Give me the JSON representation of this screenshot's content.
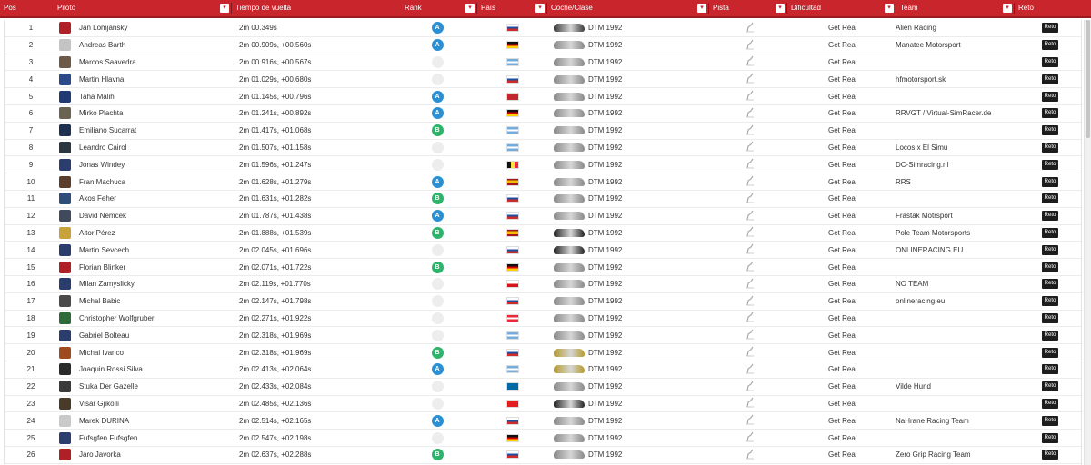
{
  "colors": {
    "header": "#c9252c",
    "rank_a": "#2b8fd3",
    "rank_b": "#2db36a",
    "reto": "#1d1d1d"
  },
  "headers": [
    {
      "key": "pos",
      "label": "Pos",
      "w": 59,
      "sortable": false
    },
    {
      "key": "piloto",
      "label": "Piloto",
      "w": 196,
      "sortable": true
    },
    {
      "key": "tiempo",
      "label": "Tiempo de vuelta",
      "w": 186,
      "sortable": false
    },
    {
      "key": "rank",
      "label": "Rank",
      "w": 84,
      "sortable": true
    },
    {
      "key": "pais",
      "label": "País",
      "w": 77,
      "sortable": true
    },
    {
      "key": "coche",
      "label": "Coche/Clase",
      "w": 178,
      "sortable": true
    },
    {
      "key": "pista",
      "label": "Pista",
      "w": 86,
      "sortable": true
    },
    {
      "key": "dificultad",
      "label": "Dificultad",
      "w": 120,
      "sortable": true
    },
    {
      "key": "team",
      "label": "Team",
      "w": 130,
      "sortable": true
    },
    {
      "key": "reto",
      "label": "Reto",
      "w": 84,
      "sortable": false
    }
  ],
  "reto_label": "Reto",
  "rows": [
    {
      "pos": "1",
      "name": "Jan Lomjansky",
      "time": "2m 00.349s",
      "rank": "A",
      "flag": "sk",
      "car_color": "#3a3a3a",
      "class": "DTM 1992",
      "difficulty": "Get Real",
      "team": "Alien Racing",
      "avatar_color": "#b02027"
    },
    {
      "pos": "2",
      "name": "Andreas Barth",
      "time": "2m 00.909s, +00.560s",
      "rank": "A",
      "flag": "de",
      "car_color": "#8a8a8a",
      "class": "DTM 1992",
      "difficulty": "Get Real",
      "team": "Manatee Motorsport",
      "avatar_color": "#c4c4c4"
    },
    {
      "pos": "3",
      "name": "Marcos Saavedra",
      "time": "2m 00.916s, +00.567s",
      "rank": "",
      "flag": "ar",
      "car_color": "#8a8a8a",
      "class": "DTM 1992",
      "difficulty": "Get Real",
      "team": "",
      "avatar_color": "#6d5a48"
    },
    {
      "pos": "4",
      "name": "Martin Hlavna",
      "time": "2m 01.029s, +00.680s",
      "rank": "",
      "flag": "sk",
      "car_color": "#8a8a8a",
      "class": "DTM 1992",
      "difficulty": "Get Real",
      "team": "hfmotorsport.sk",
      "avatar_color": "#2b4a8a"
    },
    {
      "pos": "5",
      "name": "Taha Malih",
      "time": "2m 01.145s, +00.796s",
      "rank": "A",
      "flag": "ma",
      "car_color": "#8a8a8a",
      "class": "DTM 1992",
      "difficulty": "Get Real",
      "team": "",
      "avatar_color": "#203a73"
    },
    {
      "pos": "6",
      "name": "Mirko Plachta",
      "time": "2m 01.241s, +00.892s",
      "rank": "A",
      "flag": "de",
      "car_color": "#8a8a8a",
      "class": "DTM 1992",
      "difficulty": "Get Real",
      "team": "RRVGT / Virtual-SimRacer.de",
      "avatar_color": "#6b6352"
    },
    {
      "pos": "7",
      "name": "Emiliano Sucarrat",
      "time": "2m 01.417s, +01.068s",
      "rank": "B",
      "flag": "ar",
      "car_color": "#8a8a8a",
      "class": "DTM 1992",
      "difficulty": "Get Real",
      "team": "",
      "avatar_color": "#1e2f4f"
    },
    {
      "pos": "8",
      "name": "Leandro Cairol",
      "time": "2m 01.507s, +01.158s",
      "rank": "",
      "flag": "ar",
      "car_color": "#8a8a8a",
      "class": "DTM 1992",
      "difficulty": "Get Real",
      "team": "Locos x El Simu",
      "avatar_color": "#2a3640"
    },
    {
      "pos": "9",
      "name": "Jonas Windey",
      "time": "2m 01.596s, +01.247s",
      "rank": "",
      "flag": "be",
      "car_color": "#8a8a8a",
      "class": "DTM 1992",
      "difficulty": "Get Real",
      "team": "DC-Simracing.nl",
      "avatar_color": "#2a3d6e"
    },
    {
      "pos": "10",
      "name": "Fran Machuca",
      "time": "2m 01.628s, +01.279s",
      "rank": "A",
      "flag": "es",
      "car_color": "#8a8a8a",
      "class": "DTM 1992",
      "difficulty": "Get Real",
      "team": "RRS",
      "avatar_color": "#5a3d2a"
    },
    {
      "pos": "11",
      "name": "Akos Feher",
      "time": "2m 01.631s, +01.282s",
      "rank": "B",
      "flag": "sk",
      "car_color": "#8a8a8a",
      "class": "DTM 1992",
      "difficulty": "Get Real",
      "team": "",
      "avatar_color": "#2e4d7a"
    },
    {
      "pos": "12",
      "name": "David Nemcek",
      "time": "2m 01.787s, +01.438s",
      "rank": "A",
      "flag": "sk",
      "car_color": "#8a8a8a",
      "class": "DTM 1992",
      "difficulty": "Get Real",
      "team": "Fraštâk Motrsport",
      "avatar_color": "#3f4a5c"
    },
    {
      "pos": "13",
      "name": "Aitor Pérez",
      "time": "2m 01.888s, +01.539s",
      "rank": "B",
      "flag": "es",
      "car_color": "#222222",
      "class": "DTM 1992",
      "difficulty": "Get Real",
      "team": "Pole Team Motorsports",
      "avatar_color": "#c8a23a"
    },
    {
      "pos": "14",
      "name": "Martin Sevcech",
      "time": "2m 02.045s, +01.696s",
      "rank": "",
      "flag": "sk",
      "car_color": "#222222",
      "class": "DTM 1992",
      "difficulty": "Get Real",
      "team": "ONLINERACING.EU",
      "avatar_color": "#2a3d6e"
    },
    {
      "pos": "15",
      "name": "Florian Blinker",
      "time": "2m 02.071s, +01.722s",
      "rank": "B",
      "flag": "de",
      "car_color": "#8a8a8a",
      "class": "DTM 1992",
      "difficulty": "Get Real",
      "team": "",
      "avatar_color": "#b02027"
    },
    {
      "pos": "16",
      "name": "Milan Zamyslicky",
      "time": "2m 02.119s, +01.770s",
      "rank": "",
      "flag": "cz",
      "car_color": "#8a8a8a",
      "class": "DTM 1992",
      "difficulty": "Get Real",
      "team": "NO TEAM",
      "avatar_color": "#2a3d6e"
    },
    {
      "pos": "17",
      "name": "Michal Babic",
      "time": "2m 02.147s, +01.798s",
      "rank": "",
      "flag": "sk",
      "car_color": "#8a8a8a",
      "class": "DTM 1992",
      "difficulty": "Get Real",
      "team": "onlineracing.eu",
      "avatar_color": "#4a4a4a"
    },
    {
      "pos": "18",
      "name": "Christopher Wolfgruber",
      "time": "2m 02.271s, +01.922s",
      "rank": "",
      "flag": "at",
      "car_color": "#8a8a8a",
      "class": "DTM 1992",
      "difficulty": "Get Real",
      "team": "",
      "avatar_color": "#2f6a3a"
    },
    {
      "pos": "19",
      "name": "Gabriel Bolteau",
      "time": "2m 02.318s, +01.969s",
      "rank": "",
      "flag": "ar",
      "car_color": "#8a8a8a",
      "class": "DTM 1992",
      "difficulty": "Get Real",
      "team": "",
      "avatar_color": "#2a3d6e"
    },
    {
      "pos": "20",
      "name": "Michal Ivanco",
      "time": "2m 02.318s, +01.969s",
      "rank": "B",
      "flag": "sk",
      "car_color": "#b59a2a",
      "class": "DTM 1992",
      "difficulty": "Get Real",
      "team": "",
      "avatar_color": "#a04a20"
    },
    {
      "pos": "21",
      "name": "Joaquin Rossi Silva",
      "time": "2m 02.413s, +02.064s",
      "rank": "A",
      "flag": "ar",
      "car_color": "#b59a2a",
      "class": "DTM 1992",
      "difficulty": "Get Real",
      "team": "",
      "avatar_color": "#2a2a2a"
    },
    {
      "pos": "22",
      "name": "Stuka Der Gazelle",
      "time": "2m 02.433s, +02.084s",
      "rank": "",
      "flag": "se",
      "car_color": "#8a8a8a",
      "class": "DTM 1992",
      "difficulty": "Get Real",
      "team": "Vilde Hund",
      "avatar_color": "#3a3a3a"
    },
    {
      "pos": "23",
      "name": "Visar Gjikolli",
      "time": "2m 02.485s, +02.136s",
      "rank": "",
      "flag": "al",
      "car_color": "#222222",
      "class": "DTM 1992",
      "difficulty": "Get Real",
      "team": "",
      "avatar_color": "#4a3a2a"
    },
    {
      "pos": "24",
      "name": "Marek DURINA",
      "time": "2m 02.514s, +02.165s",
      "rank": "A",
      "flag": "sk",
      "car_color": "#8a8a8a",
      "class": "DTM 1992",
      "difficulty": "Get Real",
      "team": "NaHrane Racing Team",
      "avatar_color": "#c9c9c9"
    },
    {
      "pos": "25",
      "name": "Fufsgfen Fufsgfen",
      "time": "2m 02.547s, +02.198s",
      "rank": "",
      "flag": "de",
      "car_color": "#8a8a8a",
      "class": "DTM 1992",
      "difficulty": "Get Real",
      "team": "",
      "avatar_color": "#2a3d6e"
    },
    {
      "pos": "26",
      "name": "Jaro Javorka",
      "time": "2m 02.637s, +02.288s",
      "rank": "B",
      "flag": "sk",
      "car_color": "#8a8a8a",
      "class": "DTM 1992",
      "difficulty": "Get Real",
      "team": "Zero Grip Racing Team",
      "avatar_color": "#b02027"
    }
  ]
}
